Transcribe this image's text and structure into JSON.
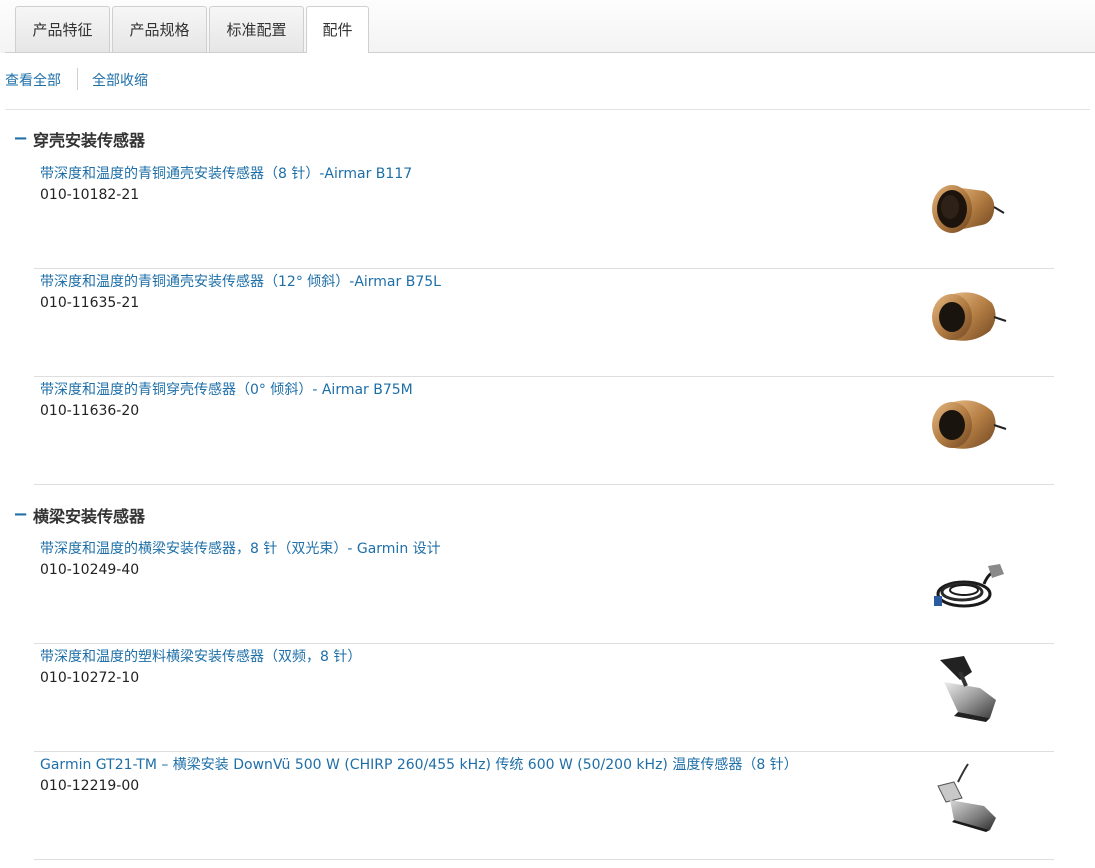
{
  "tabs": [
    {
      "label": "产品特征",
      "active": false
    },
    {
      "label": "产品规格",
      "active": false
    },
    {
      "label": "标准配置",
      "active": false
    },
    {
      "label": "配件",
      "active": true
    }
  ],
  "toolbar": {
    "expand_all": "查看全部",
    "collapse_all": "全部收缩"
  },
  "sections": [
    {
      "toggle": "−",
      "title": "穿壳安装传感器",
      "items": [
        {
          "name": "带深度和温度的青铜通壳安装传感器（8 针）-Airmar B117",
          "sku": "010-10182-21",
          "icon": "bronze-thru-hull-transducer-icon"
        },
        {
          "name": "带深度和温度的青铜通壳安装传感器（12° 倾斜）-Airmar B75L",
          "sku": "010-11635-21",
          "icon": "bronze-tilted-transducer-icon"
        },
        {
          "name": "带深度和温度的青铜穿壳传感器（0° 倾斜）- Airmar B75M",
          "sku": "010-11636-20",
          "icon": "bronze-tilted-transducer-icon"
        }
      ]
    },
    {
      "toggle": "−",
      "title": "横梁安装传感器",
      "items": [
        {
          "name": "带深度和温度的横梁安装传感器，8 针（双光束）- Garmin 设计",
          "sku": "010-10249-40",
          "icon": "transom-cable-transducer-icon"
        },
        {
          "name": "带深度和温度的塑料横梁安装传感器（双频，8 针）",
          "sku": "010-10272-10",
          "icon": "plastic-transom-transducer-icon"
        },
        {
          "name": "Garmin GT21-TM – 横梁安装 DownVü 500 W (CHIRP 260/455 kHz) 传统 600 W (50/200 kHz) 温度传感器（8 针）",
          "sku": "010-12219-00",
          "icon": "gt21-transducer-icon"
        }
      ]
    }
  ],
  "colors": {
    "link": "#1e6fa8",
    "bronze": "#b8864a",
    "divider": "#dedede"
  }
}
